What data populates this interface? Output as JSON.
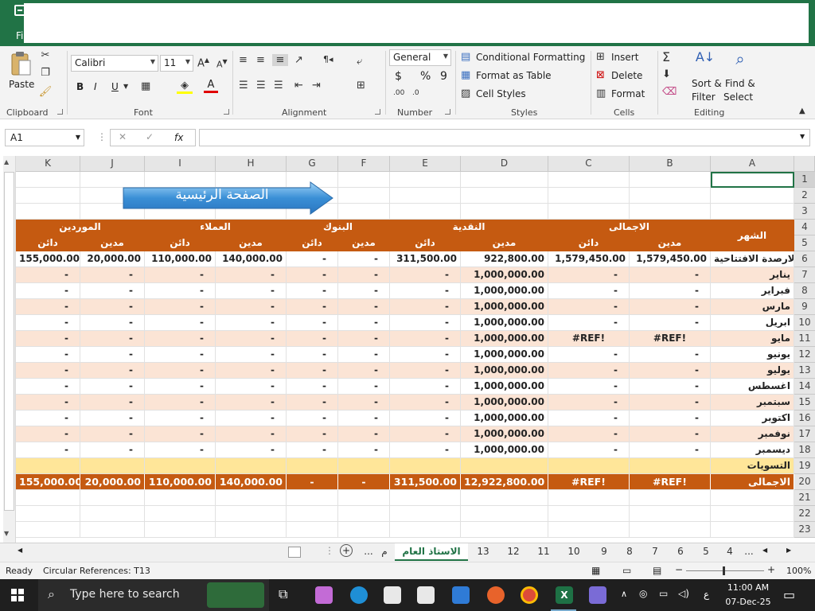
{
  "titlebar": {
    "file_tab": "Fi"
  },
  "ribbon": {
    "clipboard": {
      "paste": "Paste",
      "label": "Clipboard"
    },
    "font": {
      "name": "Calibri",
      "size": "11",
      "label": "Font",
      "bold": "B",
      "italic": "I",
      "underline": "U"
    },
    "alignment": {
      "label": "Alignment"
    },
    "number": {
      "format": "General",
      "currency": "$",
      "percent": "%",
      "comma": "9",
      "label": "Number"
    },
    "styles": {
      "conditional": "Conditional Formatting",
      "table": "Format as Table",
      "cell": "Cell Styles",
      "label": "Styles"
    },
    "cells": {
      "insert": "Insert",
      "delete": "Delete",
      "format": "Format",
      "label": "Cells"
    },
    "editing": {
      "sort": "Sort &",
      "sort2": "Filter",
      "find": "Find &",
      "find2": "Select",
      "label": "Editing"
    }
  },
  "formula_bar": {
    "name_box": "A1",
    "fx": "fx",
    "value": ""
  },
  "banner": {
    "text": "الصفحة الرئيسية"
  },
  "columns": [
    "K",
    "J",
    "I",
    "H",
    "G",
    "F",
    "E",
    "D",
    "C",
    "B",
    "A"
  ],
  "rows": [
    "1",
    "2",
    "3",
    "4",
    "5",
    "6",
    "7",
    "8",
    "9",
    "10",
    "11",
    "12",
    "13",
    "14",
    "15",
    "16",
    "17",
    "18",
    "19",
    "20",
    "21",
    "22",
    "23"
  ],
  "headers": {
    "month": "الشهر",
    "total": "الاجمالى",
    "cash": "النقدية",
    "banks": "البنوك",
    "customers": "العملاء",
    "suppliers": "الموردين",
    "debit": "مدين",
    "credit": "دائن"
  },
  "ledger": [
    {
      "month": "الارصدة الافتتاحية",
      "b": "1,579,450.00",
      "c": "1,579,450.00",
      "d": "922,800.00",
      "e": "311,500.00",
      "f": "-",
      "g": "-",
      "h": "140,000.00",
      "i": "110,000.00",
      "j": "20,000.00",
      "k": "155,000.00"
    },
    {
      "month": "يناير",
      "b": "-",
      "c": "-",
      "d": "1,000,000.00",
      "e": "-",
      "f": "-",
      "g": "-",
      "h": "-",
      "i": "-",
      "j": "-",
      "k": "-"
    },
    {
      "month": "فبراير",
      "b": "-",
      "c": "-",
      "d": "1,000,000.00",
      "e": "-",
      "f": "-",
      "g": "-",
      "h": "-",
      "i": "-",
      "j": "-",
      "k": "-"
    },
    {
      "month": "مارس",
      "b": "-",
      "c": "-",
      "d": "1,000,000.00",
      "e": "-",
      "f": "-",
      "g": "-",
      "h": "-",
      "i": "-",
      "j": "-",
      "k": "-"
    },
    {
      "month": "ابريل",
      "b": "-",
      "c": "-",
      "d": "1,000,000.00",
      "e": "-",
      "f": "-",
      "g": "-",
      "h": "-",
      "i": "-",
      "j": "-",
      "k": "-"
    },
    {
      "month": "مايو",
      "b": "#REF!",
      "c": "#REF!",
      "d": "1,000,000.00",
      "e": "-",
      "f": "-",
      "g": "-",
      "h": "-",
      "i": "-",
      "j": "-",
      "k": "-"
    },
    {
      "month": "يونيو",
      "b": "-",
      "c": "-",
      "d": "1,000,000.00",
      "e": "-",
      "f": "-",
      "g": "-",
      "h": "-",
      "i": "-",
      "j": "-",
      "k": "-"
    },
    {
      "month": "يوليو",
      "b": "-",
      "c": "-",
      "d": "1,000,000.00",
      "e": "-",
      "f": "-",
      "g": "-",
      "h": "-",
      "i": "-",
      "j": "-",
      "k": "-"
    },
    {
      "month": "اغسطس",
      "b": "-",
      "c": "-",
      "d": "1,000,000.00",
      "e": "-",
      "f": "-",
      "g": "-",
      "h": "-",
      "i": "-",
      "j": "-",
      "k": "-"
    },
    {
      "month": "سبتمبر",
      "b": "-",
      "c": "-",
      "d": "1,000,000.00",
      "e": "-",
      "f": "-",
      "g": "-",
      "h": "-",
      "i": "-",
      "j": "-",
      "k": "-"
    },
    {
      "month": "اكتوبر",
      "b": "-",
      "c": "-",
      "d": "1,000,000.00",
      "e": "-",
      "f": "-",
      "g": "-",
      "h": "-",
      "i": "-",
      "j": "-",
      "k": "-"
    },
    {
      "month": "نوفمبر",
      "b": "-",
      "c": "-",
      "d": "1,000,000.00",
      "e": "-",
      "f": "-",
      "g": "-",
      "h": "-",
      "i": "-",
      "j": "-",
      "k": "-"
    },
    {
      "month": "ديسمبر",
      "b": "-",
      "c": "-",
      "d": "1,000,000.00",
      "e": "-",
      "f": "-",
      "g": "-",
      "h": "-",
      "i": "-",
      "j": "-",
      "k": "-"
    }
  ],
  "adjustments": {
    "label": "التسويات"
  },
  "totals": {
    "label": "الاجمالى",
    "b": "#REF!",
    "c": "#REF!",
    "d": "12,922,800.00",
    "e": "311,500.00",
    "f": "-",
    "g": "-",
    "h": "140,000.00",
    "i": "110,000.00",
    "j": "20,000.00",
    "k": "155,000.00"
  },
  "sheet_tabs": {
    "active": "الاستاذ العام",
    "ellipsis": "...",
    "partial": "م",
    "others": [
      "13",
      "12",
      "11",
      "10",
      "9",
      "8",
      "7",
      "6",
      "5",
      "4"
    ]
  },
  "status": {
    "ready": "Ready",
    "circular": "Circular References: T13",
    "zoom": "100%"
  },
  "taskbar": {
    "search": "Type here to search",
    "time": "11:00 AM",
    "date": "07-Dec-25",
    "lang": "ع"
  },
  "colors": {
    "header": "#c55a11",
    "row_alt": "#fbe4d5",
    "adjust": "#ffe699",
    "excel_green": "#217346"
  }
}
